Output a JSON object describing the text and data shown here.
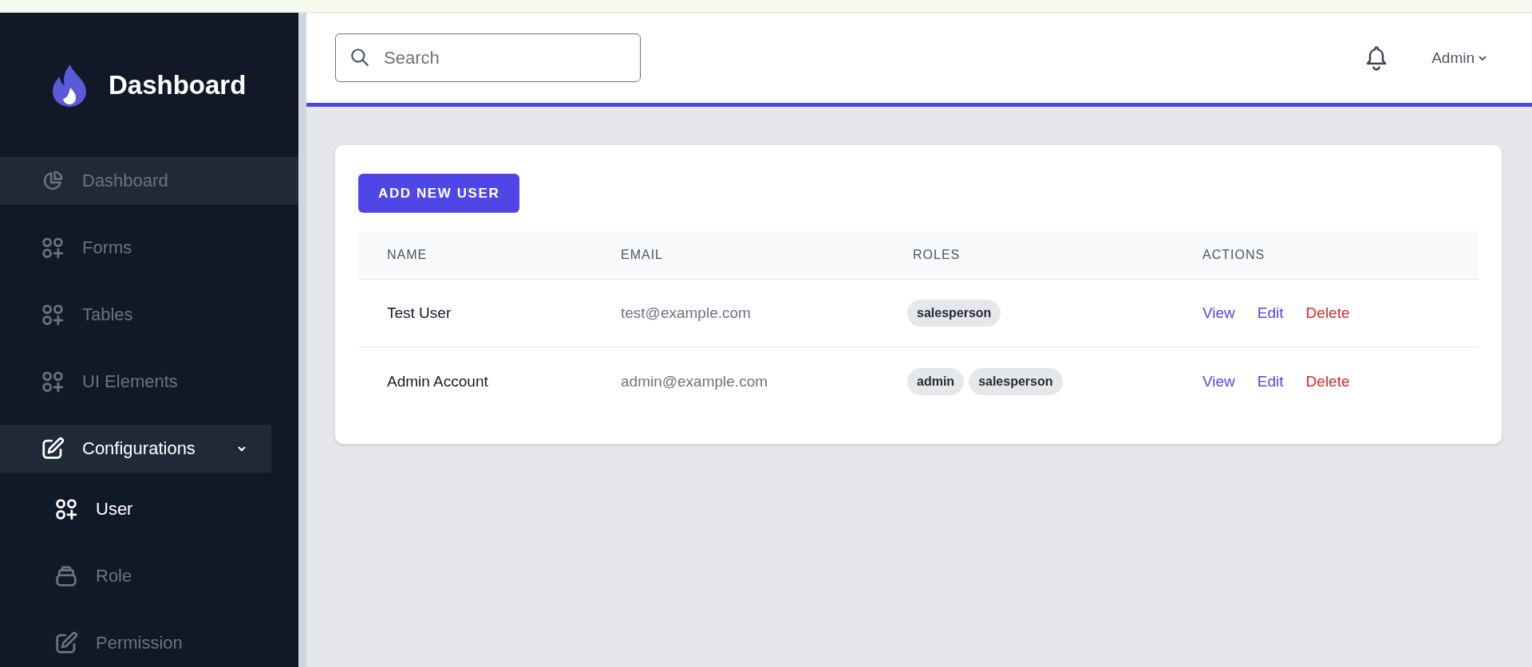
{
  "sidebar": {
    "title": "Dashboard",
    "items": [
      {
        "label": "Dashboard",
        "selected": false,
        "highlighted": true
      },
      {
        "label": "Forms",
        "selected": false,
        "highlighted": false
      },
      {
        "label": "Tables",
        "selected": false,
        "highlighted": false
      },
      {
        "label": "UI Elements",
        "selected": false,
        "highlighted": false
      },
      {
        "label": "Configurations",
        "selected": true,
        "highlighted": true,
        "expanded": true,
        "children": [
          {
            "label": "User",
            "selected": true
          },
          {
            "label": "Role",
            "selected": false
          },
          {
            "label": "Permission",
            "selected": false
          }
        ]
      }
    ]
  },
  "header": {
    "search": {
      "placeholder": "Search"
    },
    "user_menu": "Admin"
  },
  "card": {
    "button": "ADD NEW USER",
    "table": {
      "columns": [
        "NAME",
        "EMAIL",
        "ROLES",
        "ACTIONS"
      ],
      "rows": [
        {
          "name": "Test User",
          "email": "test@example.com",
          "roles": [
            "salesperson"
          ],
          "actions": [
            {
              "label": "View",
              "kind": "view"
            },
            {
              "label": "Edit",
              "kind": "edit"
            },
            {
              "label": "Delete",
              "kind": "delete"
            }
          ]
        },
        {
          "name": "Admin Account",
          "email": "admin@example.com",
          "roles": [
            "admin",
            "salesperson"
          ],
          "actions": [
            {
              "label": "View",
              "kind": "view"
            },
            {
              "label": "Edit",
              "kind": "edit"
            },
            {
              "label": "Delete",
              "kind": "delete"
            }
          ]
        }
      ]
    }
  }
}
